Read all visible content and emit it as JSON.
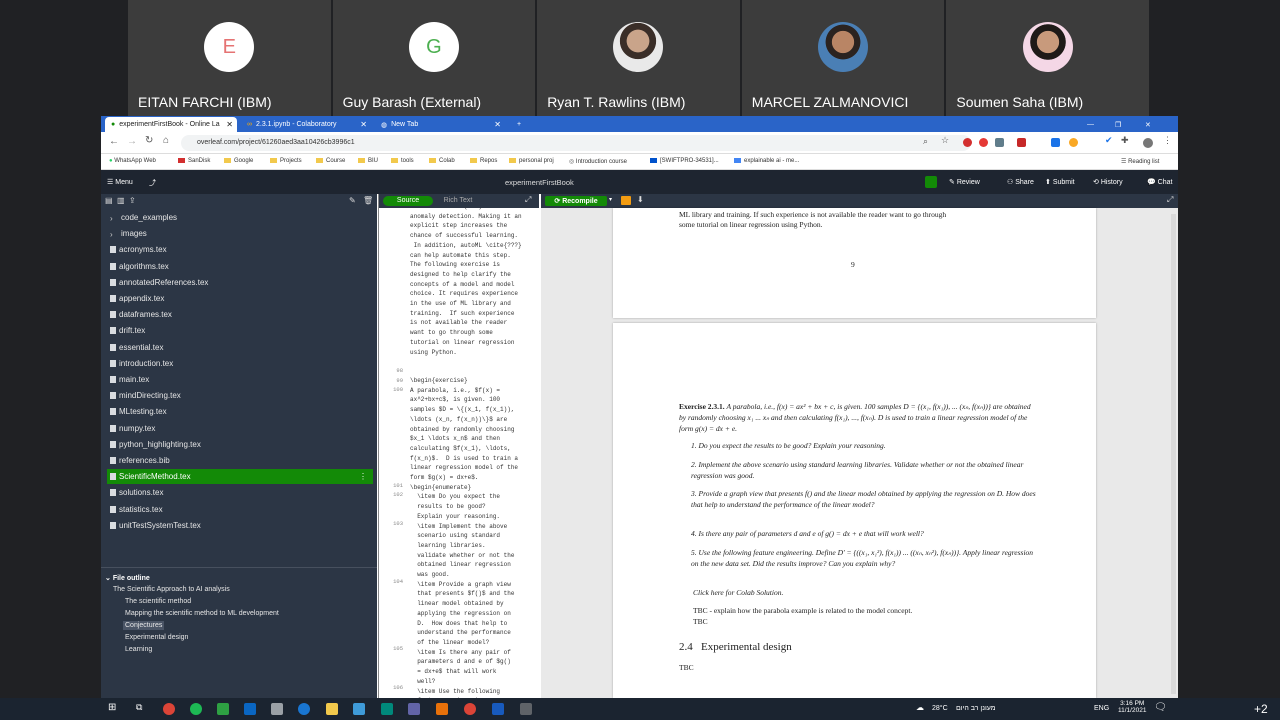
{
  "participants": [
    {
      "initial": "E",
      "name": "EITAN FARCHI (IBM)",
      "color": "#e57373"
    },
    {
      "initial": "G",
      "name": "Guy Barash (External)",
      "color": "#4caf50"
    },
    {
      "initial": "",
      "name": "Ryan T. Rawlins (IBM)",
      "color": ""
    },
    {
      "initial": "",
      "name": "MARCEL ZALMANOVICI",
      "color": ""
    },
    {
      "initial": "",
      "name": "Soumen Saha (IBM)",
      "color": ""
    }
  ],
  "browser": {
    "tabs": [
      "experimentFirstBook - Online La",
      "2.3.1.ipynb - Colaboratory",
      "New Tab"
    ],
    "url": "overleaf.com/project/61260aed3aa10426cb3996c1",
    "bookmarks": [
      "WhatsApp Web",
      "SanDisk",
      "Google",
      "Projects",
      "Course",
      "BIU",
      "tools",
      "Colab",
      "Repos",
      "personal proj",
      "Introduction course",
      "[SWIFTPRO-34531]...",
      "explainable ai - me...",
      "Reading list"
    ]
  },
  "overleaf": {
    "menu": "Menu",
    "project_title": "experimentFirstBook",
    "top_actions": [
      "Review",
      "Share",
      "Submit",
      "History",
      "Chat"
    ],
    "source_label": "Source",
    "rich_text_label": "Rich Text",
    "recompile_label": "Recompile"
  },
  "files": [
    "code_examples",
    "images",
    "acronyms.tex",
    "algorithms.tex",
    "annotatedReferences.tex",
    "appendix.tex",
    "dataframes.tex",
    "drift.tex",
    "essential.tex",
    "introduction.tex",
    "main.tex",
    "mindDirecting.tex",
    "MLtesting.tex",
    "numpy.tex",
    "python_highlighting.tex",
    "references.bib",
    "ScientificMethod.tex",
    "solutions.tex",
    "statistics.tex",
    "unitTestSystemTest.tex"
  ],
  "outline": {
    "title": "File outline",
    "items": [
      "The Scientific Approach to AI analysis",
      "The scientific method",
      "Mapping the scientific method to ML development",
      "Conjectures",
      "Experimental design",
      "Learning"
    ]
  },
  "editor": {
    "line_numbers": [
      "98",
      "99",
      "100",
      "101",
      "102",
      "103",
      "104",
      "105",
      "106"
    ],
    "block1": "neural network (CNN) for\nanomaly detection. Making it an\nexplicit step increases the\nchance of successful learning.\n In addition, autoML \\cite{???}\ncan help automate this step.\nThe following exercise is\ndesigned to help clarify the\nconcepts of a model and model\nchoice. It requires experience\nin the use of ML library and\ntraining.  If such experience\nis not available the reader\nwant to go through some\ntutorial on linear regression\nusing Python.",
    "block2": "\\begin{exercise}\nA parabola, i.e., $f(x) =\nax^2+bx+c$, is given. 100\nsamples $D = \\{(x_1, f(x_1)),\n\\ldots (x_n, f(x_n))\\}$ are\nobtained by randomly choosing\n$x_1 \\ldots x_n$ and then\ncalculating $f(x_1), \\ldots,\nf(x_n)$.  D is used to train a\nlinear regression model of the\nform $g(x) = dx+e$.\n\\begin{enumerate}\n  \\item Do you expect the\n  results to be good?\n  Explain your reasoning.\n  \\item Implement the above\n  scenario using standard\n  learning libraries.\n  validate whether or not the\n  obtained linear regression\n  was good.\n  \\item Provide a graph view\n  that presents $f()$ and the\n  linear model obtained by\n  applying the regression on\n  D.  How does that help to\n  understand the performance\n  of the linear model?\n  \\item Is there any pair of\n  parameters d and e of $g()\n  = dx+e$ that will work\n  well?\n  \\item Use the following\n  feature engineering."
  },
  "pdf": {
    "prev_page_text": "ML library and training. If such experience is not available the reader want to go through\nsome tutorial on linear regression using Python.",
    "page_number": "9",
    "exercise_head": "Exercise 2.3.1.",
    "exercise_text": "A parabola, i.e., f(x) = ax² + bx + c, is given.  100 samples D = {(x₁, f(x₁)), ... (xₙ, f(xₙ))} are obtained by randomly choosing x₁ ... xₙ and then calculating f(x₁), ..., f(xₙ). D is used to train a linear regression model of the form g(x) = dx + e.",
    "items": [
      "1.  Do you expect the results to be good? Explain your reasoning.",
      "2.  Implement the above scenario using standard learning libraries.  Validate whether or not the obtained linear regression was good.",
      "3.  Provide a graph view that presents f() and the linear model obtained by applying the regression on D. How does that help to understand the performance of the linear model?",
      "4.  Is there any pair of parameters d and e of g() = dx + e that will work well?",
      "5.  Use the following feature engineering. Define D' = {((x₁, x₁²), f(x₁)) ... ((xₙ, xₙ²), f(xₙ))}. Apply linear regression on the new data set. Did the results improve? Can you explain why?"
    ],
    "colab_link": "Click here for Colab Solution.",
    "tbc1": "TBC - explain how the parabola example is related to the model concept.",
    "tbc2": "TBC",
    "section": "2.4   Experimental design",
    "tbc3": "TBC"
  },
  "taskbar": {
    "weather": "28°C",
    "weather_text": "מעונן רב היום",
    "lang": "ENG",
    "time": "3:16 PM",
    "date": "11/1/2021",
    "notif": "+2"
  }
}
